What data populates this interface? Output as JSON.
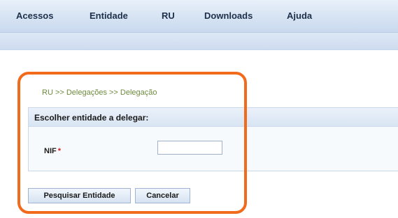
{
  "nav": {
    "items": [
      {
        "label": "Acessos"
      },
      {
        "label": "Entidade"
      },
      {
        "label": "RU"
      },
      {
        "label": "Downloads"
      },
      {
        "label": "Ajuda"
      }
    ]
  },
  "breadcrumb": "RU >> Delegações >> Delegação",
  "form": {
    "title": "Escolher entidade a delegar:",
    "nif_label": "NIF",
    "required_marker": "*",
    "nif_value": "",
    "nif_placeholder": ""
  },
  "buttons": {
    "search_label": "Pesquisar Entidade",
    "cancel_label": "Cancelar"
  },
  "colors": {
    "highlight": "#f26a1b",
    "nav_background": "#d6e3f3",
    "breadcrumb_text": "#6e8a3e",
    "required": "#d21f1f"
  }
}
